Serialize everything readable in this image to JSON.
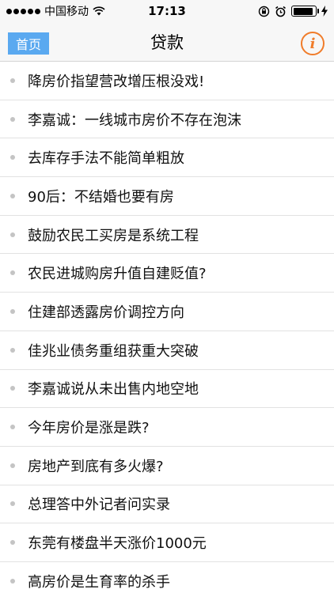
{
  "status_bar": {
    "carrier": "中国移动",
    "time": "17:13",
    "battery_level": 0.9
  },
  "nav": {
    "home_label": "首页",
    "title": "贷款",
    "info_glyph": "i"
  },
  "news": [
    "降房价指望营改增压根没戏!",
    "李嘉诚：一线城市房价不存在泡沫",
    "去库存手法不能简单粗放",
    "90后：不结婚也要有房",
    "鼓励农民工买房是系统工程",
    "农民进城购房升值自建贬值?",
    "住建部透露房价调控方向",
    "佳兆业债务重组获重大突破",
    "李嘉诚说从未出售内地空地",
    "今年房价是涨是跌?",
    "房地产到底有多火爆?",
    "总理答中外记者问实录",
    "东莞有楼盘半天涨价1000元",
    "高房价是生育率的杀手"
  ],
  "colors": {
    "home_button_bg": "#5aa9f0",
    "info_accent": "#f07c2a",
    "bullet": "#c4c4c4"
  }
}
